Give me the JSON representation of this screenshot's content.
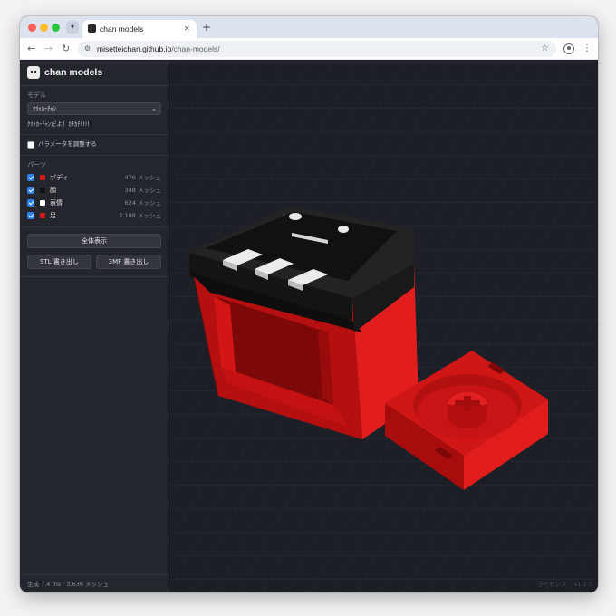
{
  "browser": {
    "tab_title": "chan models",
    "tab_close": "×",
    "new_tab": "+",
    "url_host": "misetteichan.github.io",
    "url_path": "/chan-models/",
    "icons": [
      "search-tabs-icon",
      "back-icon",
      "forward-icon",
      "reload-icon",
      "site-info-icon",
      "star-icon",
      "profile-icon",
      "menu-icon"
    ]
  },
  "sidebar": {
    "app_title": "chan models",
    "model_label": "モデル",
    "model_selected": "ｸﾘｯｶｰﾁｬﾝ",
    "model_description": "ｸﾘｯｶｰﾁｬﾝだよ！ｶﾁｶﾁ!!!!",
    "params_label": "パラメータを調整する",
    "params_checked": false,
    "parts_label": "パーツ",
    "parts": [
      {
        "name": "ボディ",
        "count": "476 メッシュ",
        "color": "#d01818",
        "checked": true
      },
      {
        "name": "顔",
        "count": "348 メッシュ",
        "color": "#111111",
        "checked": true
      },
      {
        "name": "表情",
        "count": "624 メッシュ",
        "color": "#ffffff",
        "checked": true
      },
      {
        "name": "足",
        "count": "2,188 メッシュ",
        "color": "#d01818",
        "checked": true
      }
    ],
    "fit_view_label": "全体表示",
    "stl_export_label": "STL 書き出し",
    "3mf_export_label": "3MF 書き出し",
    "status": "生成 7.4 ms · 3,636 メッシュ"
  },
  "viewport": {
    "license_label": "ライセンス",
    "version": "v1.2.0"
  }
}
